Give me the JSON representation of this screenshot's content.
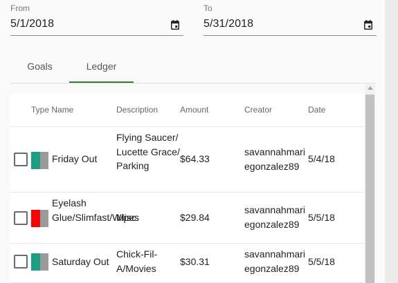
{
  "date_range": {
    "from_label": "From",
    "from_value": "5/1/2018",
    "to_label": "To",
    "to_value": "5/31/2018"
  },
  "tabs": [
    {
      "label": "Goals",
      "active": false
    },
    {
      "label": "Ledger",
      "active": true
    }
  ],
  "colors": {
    "active_tab": "#2e7d32",
    "type_teal": "#1a9e84",
    "type_red": "#ff0000",
    "type_gray": "#9a9a9a"
  },
  "ledger": {
    "headers": {
      "type_name": "Type Name",
      "description": "Description",
      "amount": "Amount",
      "creator": "Creator",
      "date": "Date"
    },
    "rows": [
      {
        "name": "Friday Out",
        "description": "Flying Saucer/Lucette Grace/Parking",
        "amount": "$64.33",
        "creator": "savannahmariegonzalez89",
        "date": "5/4/18",
        "type_color": "#1a9e84"
      },
      {
        "name": "Eyelash Glue/Slimfast/Wipes",
        "description": "Misc.",
        "amount": "$29.84",
        "creator": "savannahmariegonzalez89",
        "date": "5/5/18",
        "type_color": "#ff0000"
      },
      {
        "name": "Saturday Out",
        "description": "Chick-Fil-A/Movies",
        "amount": "$30.31",
        "creator": "savannahmariegonzalez89",
        "date": "5/5/18",
        "type_color": "#1a9e84"
      }
    ]
  }
}
